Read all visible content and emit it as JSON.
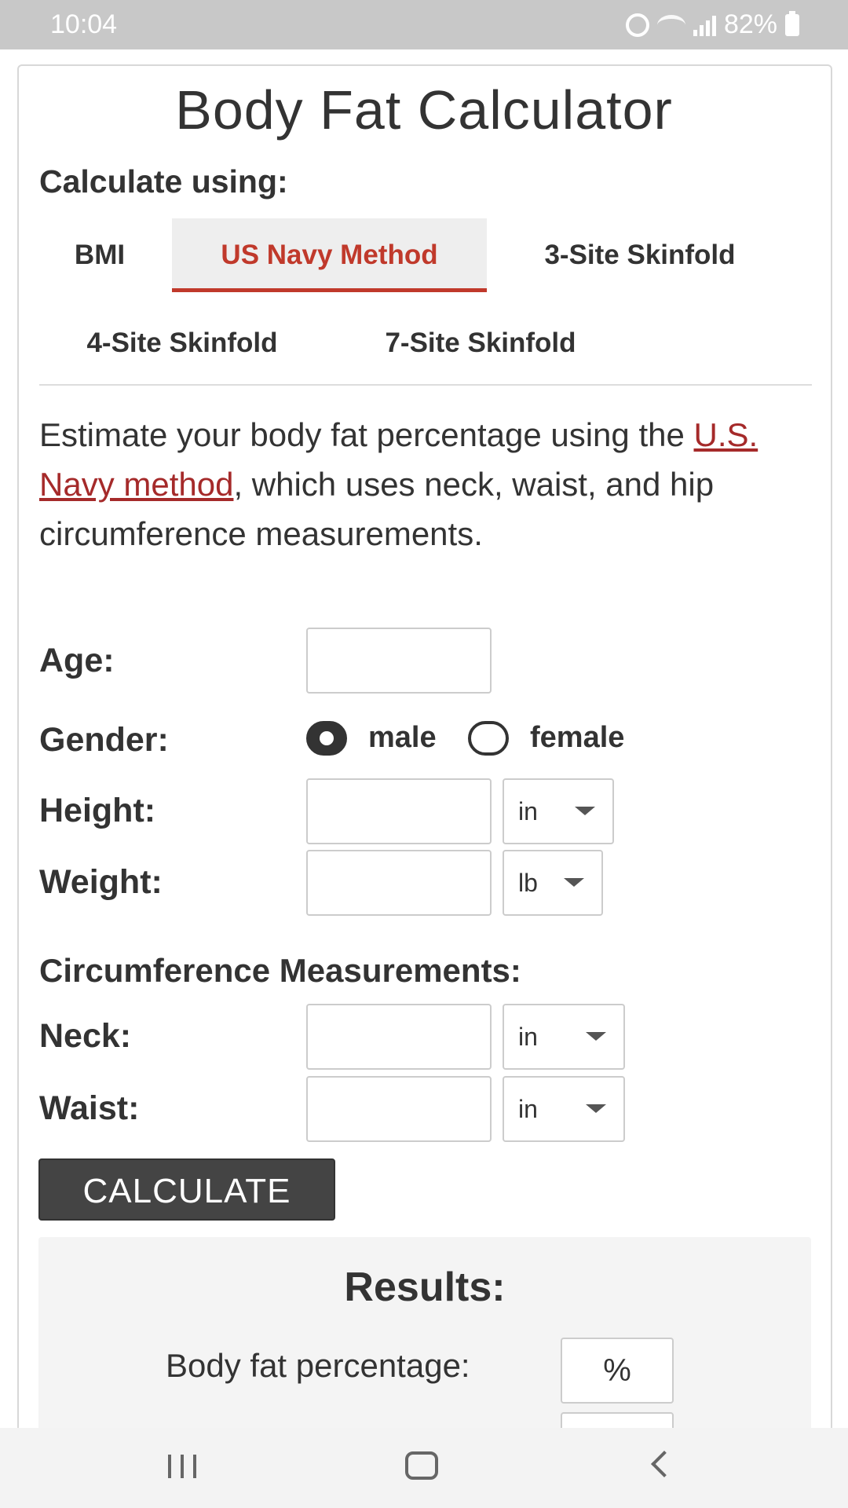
{
  "status_bar": {
    "time": "10:04",
    "battery": "82%",
    "icons": [
      "alarm-icon",
      "wifi-icon",
      "signal-icon",
      "battery-icon"
    ]
  },
  "page": {
    "title": "Body Fat Calculator",
    "calculate_using": "Calculate using:"
  },
  "tabs": [
    {
      "label": "BMI",
      "active": false
    },
    {
      "label": "US Navy Method",
      "active": true
    },
    {
      "label": "3-Site Skinfold",
      "active": false
    },
    {
      "label": "4-Site Skinfold",
      "active": false
    },
    {
      "label": "7-Site Skinfold",
      "active": false
    }
  ],
  "description": {
    "before": "Estimate your body fat percentage using the ",
    "link": "U.S. Navy method",
    "after": ", which uses neck, waist, and hip circumference measurements."
  },
  "form": {
    "age_label": "Age:",
    "age_value": "",
    "gender_label": "Gender:",
    "gender_options": [
      "male",
      "female"
    ],
    "gender_selected": "male",
    "height_label": "Height:",
    "height_value": "",
    "height_unit": "in",
    "weight_label": "Weight:",
    "weight_value": "",
    "weight_unit": "lb",
    "circumference_heading": "Circumference Measurements:",
    "neck_label": "Neck:",
    "neck_value": "",
    "neck_unit": "in",
    "waist_label": "Waist:",
    "waist_value": "",
    "waist_unit": "in",
    "calculate_button": "CALCULATE"
  },
  "results": {
    "title": "Results:",
    "body_fat_label": "Body fat percentage:",
    "body_fat_value": "%"
  },
  "colors": {
    "accent": "#c0392b",
    "link": "#a52a2a",
    "button": "#444444",
    "status_bar": "#c8c8c8"
  }
}
